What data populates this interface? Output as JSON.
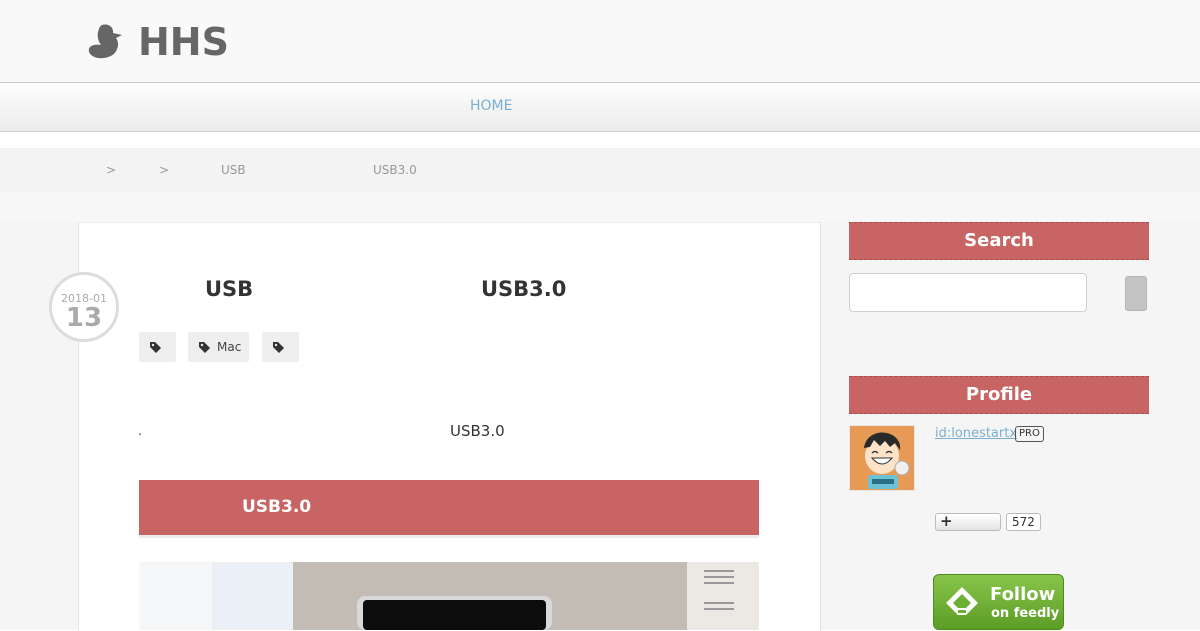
{
  "site": {
    "logo_text": "HHS",
    "logo_icon": "duck-icon"
  },
  "nav": {
    "home_label": "HOME"
  },
  "breadcrumb": {
    "sep1": ">",
    "sep2": ">",
    "item_usb": "USB",
    "item_usb3": "USB3.0"
  },
  "article": {
    "date_year_month": "2018-01",
    "date_day": "13",
    "title_part1": "USB",
    "title_part2": "USB3.0",
    "tags": [
      {
        "label": "",
        "icon": "tag-icon"
      },
      {
        "label": "Mac",
        "icon": "tag-icon"
      },
      {
        "label": "",
        "icon": "tag-icon"
      }
    ],
    "intro_dot": ".",
    "intro_text": "USB3.0",
    "section_heading": "USB3.0"
  },
  "sidebar": {
    "search_title": "Search",
    "search_input_value": "",
    "profile_title": "Profile",
    "profile_id": "id:lonestartx",
    "pro_badge": "PRO",
    "follow_button_icon": "plus-icon",
    "follower_count": "572",
    "feedly_line1": "Follow",
    "feedly_line2": "on feedly"
  },
  "colors": {
    "accent_red": "#c86464",
    "link_blue": "#7ab0cf",
    "feedly_green": "#6cb033"
  }
}
